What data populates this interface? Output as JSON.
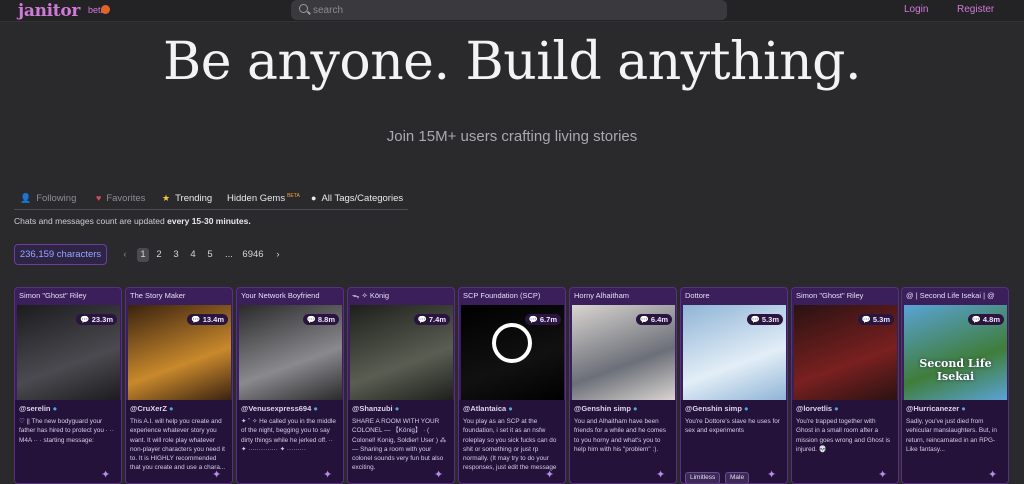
{
  "header": {
    "logo": "janitor",
    "beta": "beta",
    "search_placeholder": "search",
    "login": "Login",
    "register": "Register"
  },
  "hero": {
    "title": "Be anyone. Build anything.",
    "subtitle": "Join 15M+ users crafting living stories"
  },
  "tabs": [
    {
      "label": "Following",
      "icon": "person-icon"
    },
    {
      "label": "Favorites",
      "icon": "heart-icon"
    },
    {
      "label": "Trending",
      "icon": "star-icon"
    },
    {
      "label": "Hidden Gems",
      "icon": "gem-icon",
      "badge": "BETA"
    },
    {
      "label": "All Tags/Categories",
      "icon": "circle-icon"
    }
  ],
  "note": {
    "prefix": "Chats and messages count are updated ",
    "bold": "every 15-30 minutes."
  },
  "count": "236,159 characters",
  "pager": {
    "prev": "‹",
    "pages": [
      "1",
      "2",
      "3",
      "4",
      "5",
      "...",
      "6946"
    ],
    "next": "›",
    "current": "1"
  },
  "cards": [
    {
      "name": "Simon \"Ghost\" Riley",
      "stat": "23.3m",
      "author": "@serelin",
      "desc": "♡ || The new bodyguard your father has hired to protect you · ·· M4A ·· · starting message:",
      "colors": [
        "#1c1c1f",
        "#4a4a50"
      ]
    },
    {
      "name": "The Story Maker",
      "stat": "13.4m",
      "author": "@CruXerZ",
      "desc": "This A.I. will help you create and experience whatever story you want. It will role play whatever non-player characters you need it to. It is HIGHLY recommended that you create and use a chara...",
      "colors": [
        "#3a2210",
        "#c9892c"
      ]
    },
    {
      "name": "Your Network Boyfriend",
      "stat": "8.8m",
      "author": "@Venusexpress694",
      "desc": "✦ ˚ ✧ He called you in the middle of the night, begging you to say dirty things while he jerked off. ·· ✦ ·············· ✦ ·········",
      "colors": [
        "#2a2a2c",
        "#8a8a8e"
      ]
    },
    {
      "name": "ᯓ ✧ König",
      "stat": "7.4m",
      "author": "@Shanzubi",
      "desc": "SHARE A ROOM WITH YOUR COLONEL — 【König】 · ( Colonel! Konig, Soldier! User ) ⁂ — Sharing a room with your colonel sounds very fun but also exciting.",
      "colors": [
        "#1e1f1c",
        "#5a5e52"
      ]
    },
    {
      "name": "SCP Foundation (SCP)",
      "stat": "6.7m",
      "author": "@Atlantaica",
      "desc": "You play as an SCP at the foundation, i set it as an nsfw roleplay so you sick fucks can do shit or something or just rp normally. (It may try to do your responses, just edit the message",
      "colors": [
        "#000000",
        "#111111"
      ]
    },
    {
      "name": "Horny Alhaitham",
      "stat": "6.4m",
      "author": "@Genshin simp",
      "desc": "You and Alhaitham have been friends for a while and he comes to you horny and what's you to help him with his \"problem\" :).",
      "colors": [
        "#d9d4d0",
        "#6b6f78"
      ]
    },
    {
      "name": "Dottore",
      "stat": "5.3m",
      "author": "@Genshin simp",
      "desc": "You're Dottore's slave he uses for sex and experiments",
      "colors": [
        "#8fb4d6",
        "#e3eef7"
      ],
      "chips": [
        "Limitless",
        "Male"
      ]
    },
    {
      "name": "Simon \"Ghost\" Riley",
      "stat": "5.3m",
      "author": "@lorvetlis",
      "desc": "You're trapped together with Ghost in a small room after a mission goes wrong and Ghost is injured. 💀",
      "colors": [
        "#2a1212",
        "#7a2020"
      ]
    },
    {
      "name": "@ | Second Life Isekai | @",
      "stat": "4.8m",
      "author": "@Hurricanezer",
      "desc": "Sadly, you've just died from vehicular manslaughters. But, in return, reincarnated in an RPG-Like fantasy...",
      "colors": [
        "#5aa3d6",
        "#3f7d3a"
      ],
      "overlay": "Second Life Isekai"
    }
  ],
  "icons": {
    "stat": "chat-bubble-icon",
    "verified": "verified-badge-icon"
  }
}
